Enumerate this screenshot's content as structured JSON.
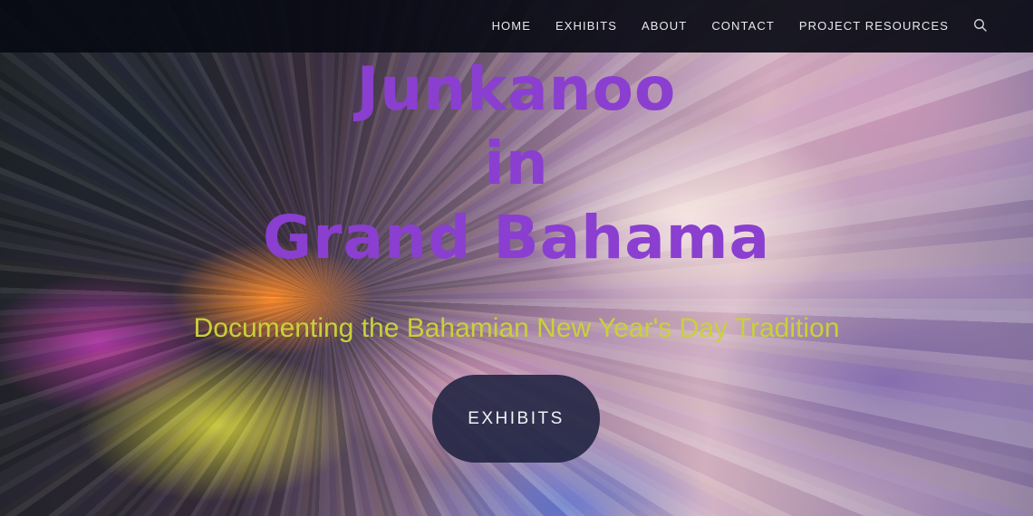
{
  "header": {
    "nav": [
      {
        "label": "HOME"
      },
      {
        "label": "EXHIBITS"
      },
      {
        "label": "ABOUT"
      },
      {
        "label": "CONTACT"
      },
      {
        "label": "PROJECT RESOURCES"
      }
    ],
    "search_icon": "search-icon"
  },
  "hero": {
    "title_lines": [
      "Junkanoo",
      "in",
      "Grand Bahama"
    ],
    "subtitle": "Documenting the Bahamian New Year's Day Tradition",
    "cta_label": "EXHIBITS"
  },
  "colors": {
    "title": "#8a3fd0",
    "subtitle": "#c9d138",
    "header_bg": "#080a14",
    "button_bg": "#1e2240"
  }
}
